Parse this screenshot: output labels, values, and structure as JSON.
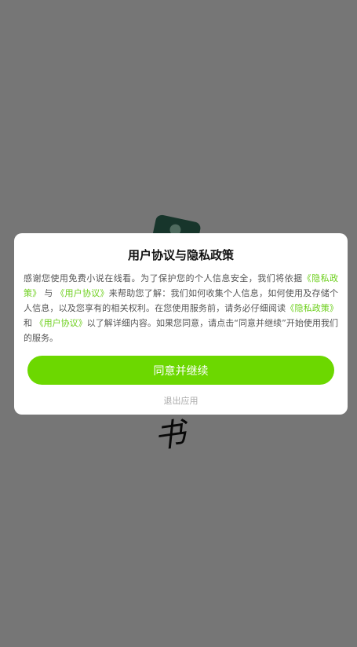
{
  "dialog": {
    "title": "用户协议与隐私政策",
    "body_1": "感谢您使用免费小说在线看。为了保护您的个人信息安全，我们将依据",
    "privacy_link_1": "《隐私政策》",
    "and_1": " 与 ",
    "user_link_1": "《用户协议》",
    "body_2": "来帮助您了解：我们如何收集个人信息，如何使用及存储个人信息，以及您享有的相关权利。在您使用服务前，请务必仔细阅读",
    "privacy_link_2": "《隐私政策》",
    "and_2": " 和 ",
    "user_link_2": "《用户协议》",
    "body_3": "以了解详细内容。如果您同意，请点击“同意并继续”开始使用我们的服务。",
    "agree_label": "同意并继续",
    "exit_label": "退出应用"
  },
  "splash": {
    "logo_glyph": "书"
  },
  "colors": {
    "accent": "#6cd800",
    "link": "#6ccf1b"
  }
}
